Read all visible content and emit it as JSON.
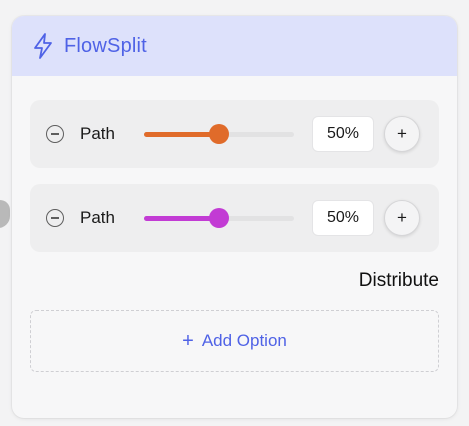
{
  "node": {
    "title": "FlowSplit",
    "icon": "lightning-bolt-icon",
    "accent_color": "#4f62e6",
    "header_bg": "#dde1fb"
  },
  "paths": [
    {
      "label": "Path",
      "value": 50,
      "value_text": "50%",
      "color": "#e06b2a"
    },
    {
      "label": "Path",
      "value": 50,
      "value_text": "50%",
      "color": "#c23bd4"
    }
  ],
  "actions": {
    "distribute_label": "Distribute",
    "add_option_label": "Add Option",
    "increment_label": "+"
  }
}
